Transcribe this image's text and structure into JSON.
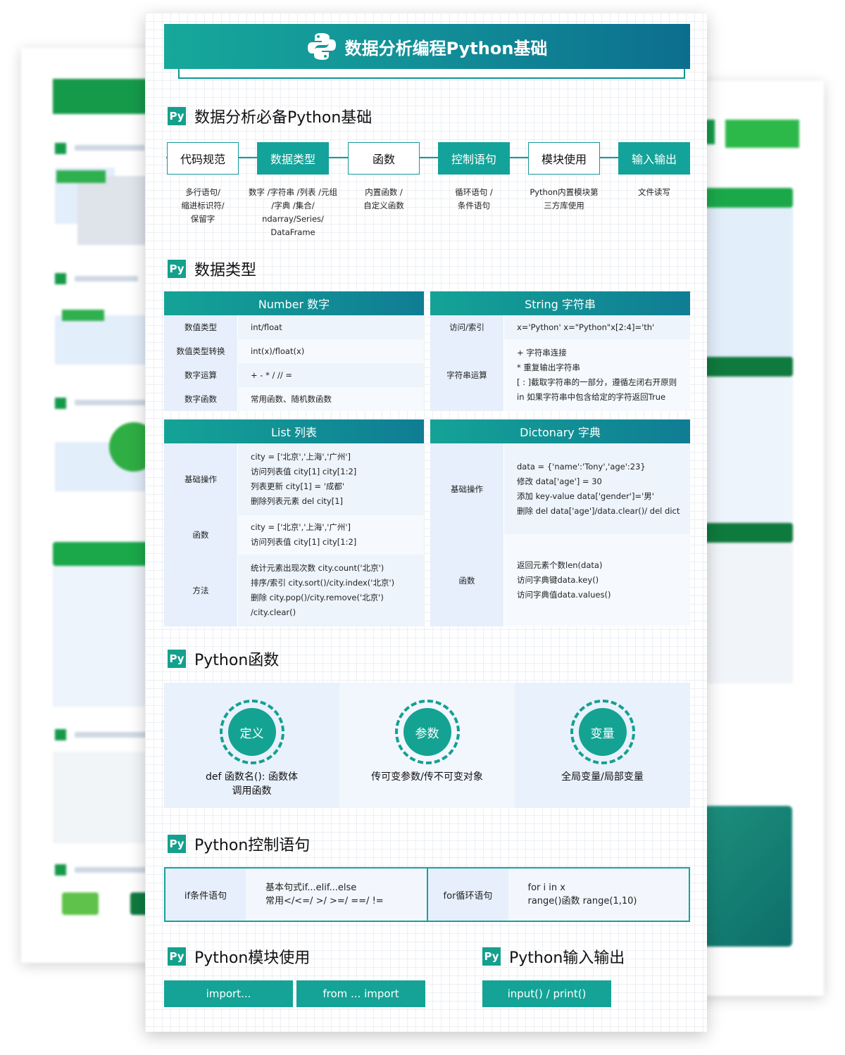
{
  "banner": {
    "title": "数据分析编程Python基础",
    "logo_icon": "python-logo-icon"
  },
  "badge_text": "Py",
  "sections": {
    "basics": "数据分析必备Python基础",
    "types": "数据类型",
    "functions": "Python函数",
    "control": "Python控制语句",
    "modules": "Python模块使用",
    "io": "Python输入输出"
  },
  "flow": [
    {
      "label": "代码规范",
      "desc": [
        "多行语句/",
        "缩进标识符/",
        "保留字"
      ]
    },
    {
      "label": "数据类型",
      "desc": [
        "数字 /字符串 /列表 /元组",
        "/字典 /集合/",
        "ndarray/Series/",
        "DataFrame"
      ]
    },
    {
      "label": "函数",
      "desc": [
        "内置函数 /",
        "自定义函数"
      ]
    },
    {
      "label": "控制语句",
      "desc": [
        "循环语句 /",
        "条件语句"
      ]
    },
    {
      "label": "模块使用",
      "desc": [
        "Python内置模块第",
        "三方库使用"
      ]
    },
    {
      "label": "输入输出",
      "desc": [
        "文件读写"
      ]
    }
  ],
  "tables": {
    "number": {
      "title": "Number 数字",
      "rows": [
        {
          "k": "数值类型",
          "v": [
            "int/float"
          ]
        },
        {
          "k": "数值类型转换",
          "v": [
            "int(x)/float(x)"
          ]
        },
        {
          "k": "数字运算",
          "v": [
            "+ - * / // ="
          ]
        },
        {
          "k": "数字函数",
          "v": [
            "常用函数、随机数函数"
          ]
        }
      ]
    },
    "string": {
      "title": "String 字符串",
      "rows": [
        {
          "k": "访问/索引",
          "v": [
            "x='Python' x=\"Python\"x[2:4]='th'"
          ]
        },
        {
          "k": "字符串运算",
          "v": [
            "+ 字符串连接",
            "* 重复输出字符串",
            "[ : ]截取字符串的一部分，遵循左闭右开原则",
            "in 如果字符串中包含给定的字符返回True"
          ]
        }
      ]
    },
    "list": {
      "title": "List 列表",
      "rows": [
        {
          "k": "基础操作",
          "v": [
            "city = ['北京','上海','广州']",
            "访问列表值 city[1] city[1:2]",
            "列表更新 city[1] = '成都'",
            "删除列表元素 del city[1]"
          ]
        },
        {
          "k": "函数",
          "v": [
            "city = ['北京','上海','广州']",
            "访问列表值 city[1] city[1:2]"
          ]
        },
        {
          "k": "方法",
          "v": [
            "统计元素出现次数 city.count('北京')",
            "排序/索引 city.sort()/city.index('北京')",
            "删除 city.pop()/city.remove('北京')",
            "/city.clear()"
          ]
        }
      ]
    },
    "dict": {
      "title": "Dictonary 字典",
      "rows": [
        {
          "k": "基础操作",
          "v": [
            "data = {'name':'Tony','age':23}",
            "修改 data['age'] = 30",
            "添加 key-value   data['gender']='男'",
            "删除 del data['age']/data.clear()/ del dict"
          ]
        },
        {
          "k": "函数",
          "v": [
            "返回元素个数len(data)",
            "访问字典键data.key()",
            "访问字典值data.values()"
          ]
        }
      ]
    }
  },
  "functions": [
    {
      "label": "定义",
      "desc": [
        "def 函数名():  函数体",
        "调用函数"
      ]
    },
    {
      "label": "参数",
      "desc": [
        "传可变参数/传不可变对象"
      ]
    },
    {
      "label": "变量",
      "desc": [
        "全局变量/局部变量"
      ]
    }
  ],
  "control": [
    {
      "k": "if条件语句",
      "v": [
        "基本句式if...elif...else",
        "常用</<=/ >/ >=/ ==/ !="
      ]
    },
    {
      "k": "for循环语句",
      "v": [
        "for i in x",
        "range()函数 range(1,10)"
      ]
    }
  ],
  "modules": [
    "import...",
    "from ... import"
  ],
  "io": [
    "input() / print()"
  ],
  "colors": {
    "teal": "#14a39a",
    "teal_dark": "#0c6e8e",
    "cell_blue": "#e6effb",
    "background_green": "#159a4a"
  }
}
